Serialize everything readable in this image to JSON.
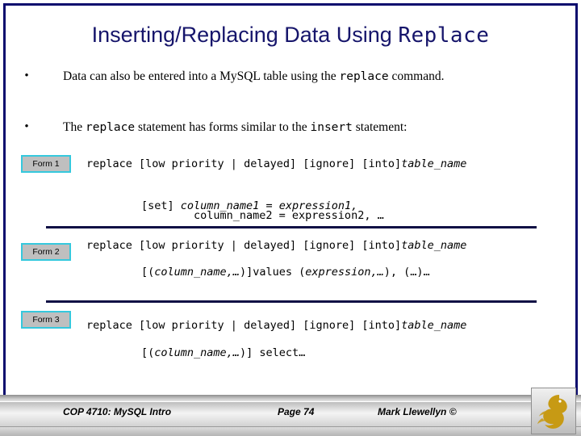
{
  "slide": {
    "title_plain": "Inserting/Replacing Data Using ",
    "title_mono": "Replace",
    "border_color": "#0b0b6e",
    "title_color": "#16156b"
  },
  "bullets": [
    {
      "marker": "•",
      "part1": "Data can also be entered into a MySQL table using the ",
      "mono1": "replace",
      "part2": " command."
    },
    {
      "marker": "•",
      "part1": "The ",
      "mono1": "replace",
      "part2": " statement has forms similar to the ",
      "mono2": "insert",
      "part3": " statement:"
    }
  ],
  "forms": [
    {
      "badge": "Form 1",
      "lines": [
        {
          "code": "replace [low priority | delayed] [ignore] [into]",
          "italic": "table_name"
        },
        {
          "code": "[set] ",
          "italic": "column_name1 = expression1,"
        },
        {
          "code": "column_name2 = expression2, …",
          "italic": ""
        }
      ]
    },
    {
      "badge": "Form 2",
      "lines": [
        {
          "code": "replace [low priority | delayed] [ignore] [into]",
          "italic": "table_name"
        },
        {
          "code": "[(",
          "italic": "column_name,…"
        },
        {
          "code": ")]values (",
          "italic": "expression,…"
        }
      ]
    },
    {
      "badge": "Form 3",
      "lines": [
        {
          "code": "replace [low priority | delayed] [ignore] [into]",
          "italic": "table_name"
        },
        {
          "code": "[(",
          "italic": "column_name,…"
        },
        {
          "code": ")] select…",
          "italic": ""
        }
      ]
    }
  ],
  "code_text": {
    "form1_line1_a": "replace [low priority | delayed] [ignore] [into]",
    "form1_line1_b": "table_name",
    "form1_line2_a": "[set] ",
    "form1_line2_b": "column_name1 = expression1,",
    "form1_line3": "column_name2 = expression2, …",
    "form2_line1_a": "replace [low priority | delayed] [ignore] [into]",
    "form2_line1_b": "table_name",
    "form2_line2_a": "[(",
    "form2_line2_b": "column_name,…",
    "form2_line2_c": ")]values (",
    "form2_line2_d": "expression,…",
    "form2_line2_e": "),  (…)…",
    "form3_line1_a": "replace [low priority | delayed] [ignore] [into]",
    "form3_line1_b": "table_name",
    "form3_line2_a": "[(",
    "form3_line2_b": "column_name,…",
    "form3_line2_c": ")] select…"
  },
  "footer": {
    "course": "COP 4710: MySQL Intro",
    "page": "Page 74",
    "author": "Mark Llewellyn ©",
    "logo_color": "#c79a14"
  }
}
